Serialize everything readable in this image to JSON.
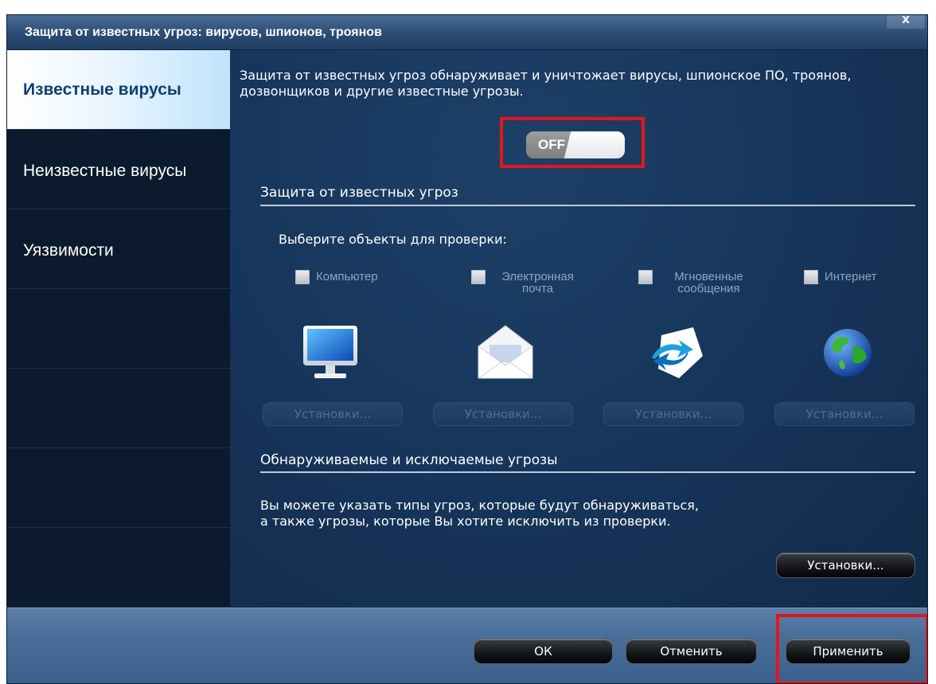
{
  "window": {
    "title": "Защита от известных угроз: вирусов, шпионов, троянов",
    "close_label": "x"
  },
  "sidebar": {
    "items": [
      {
        "label": "Известные вирусы",
        "active": true
      },
      {
        "label": "Неизвестные вирусы",
        "active": false
      },
      {
        "label": "Уязвимости",
        "active": false
      }
    ]
  },
  "main": {
    "description": "Защита от известных угроз обнаруживает и уничтожает вирусы, шпионское ПО, троянов, дозвонщиков и другие известные угрозы.",
    "toggle": {
      "label": "OFF",
      "state": "off"
    },
    "known_threats": {
      "section_title": "Защита от известных угроз",
      "prompt": "Выберите объекты для проверки:",
      "objects": [
        {
          "label": "Компьютер",
          "icon": "monitor-icon",
          "checked": false,
          "settings_label": "Установки..."
        },
        {
          "label": "Электронная почта",
          "icon": "envelope-icon",
          "checked": false,
          "settings_label": "Установки..."
        },
        {
          "label": "Мгновенные сообщения",
          "icon": "instant-messaging-icon",
          "checked": false,
          "settings_label": "Установки..."
        },
        {
          "label": "Интернет",
          "icon": "globe-icon",
          "checked": false,
          "settings_label": "Установки..."
        }
      ]
    },
    "detected_excluded": {
      "section_title": "Обнаруживаемые и исключаемые угрозы",
      "description": "Вы можете указать типы угроз, которые будут обнаруживаться, а также угрозы, которые Вы хотите исключить из проверки.",
      "settings_label": "Установки..."
    }
  },
  "footer": {
    "ok_label": "ОК",
    "cancel_label": "Отменить",
    "apply_label": "Применить"
  },
  "colors": {
    "highlight_box": "#e3161c",
    "content_bg": "#163459",
    "sidebar_bg": "#0b1a2c"
  }
}
